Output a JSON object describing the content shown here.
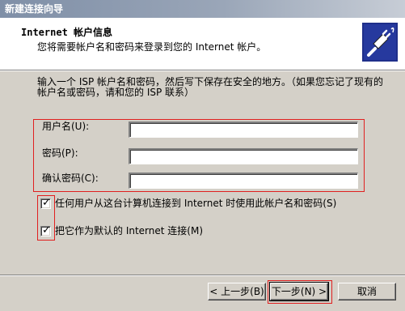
{
  "window": {
    "title": "新建连接向导"
  },
  "header": {
    "title": "Internet 帐户信息",
    "subtitle": "您将需要帐户名和密码来登录到您的 Internet 帐户。",
    "icon": "wizard-connection-icon"
  },
  "intro": "输入一个 ISP 帐户名和密码，然后写下保存在安全的地方。（如果您忘记了现有的帐户名或密码，请和您的 ISP 联系）",
  "form": {
    "username_label": "用户名(U):",
    "username_value": "",
    "password_label": "密码(P):",
    "password_value": "",
    "confirm_label": "确认密码(C):",
    "confirm_value": ""
  },
  "options": {
    "any_user": {
      "label": "任何用户从这台计算机连接到 Internet 时使用此帐户名和密码(S)",
      "checked": true
    },
    "default_conn": {
      "label": "把它作为默认的 Internet 连接(M)",
      "checked": true
    }
  },
  "buttons": {
    "back": "< 上一步(B)",
    "next": "下一步(N) >",
    "cancel": "取消"
  },
  "colors": {
    "highlight_box": "#e02020",
    "title_gradient_start": "#7f8fa7",
    "dialog_bg": "#d4d0c8"
  }
}
